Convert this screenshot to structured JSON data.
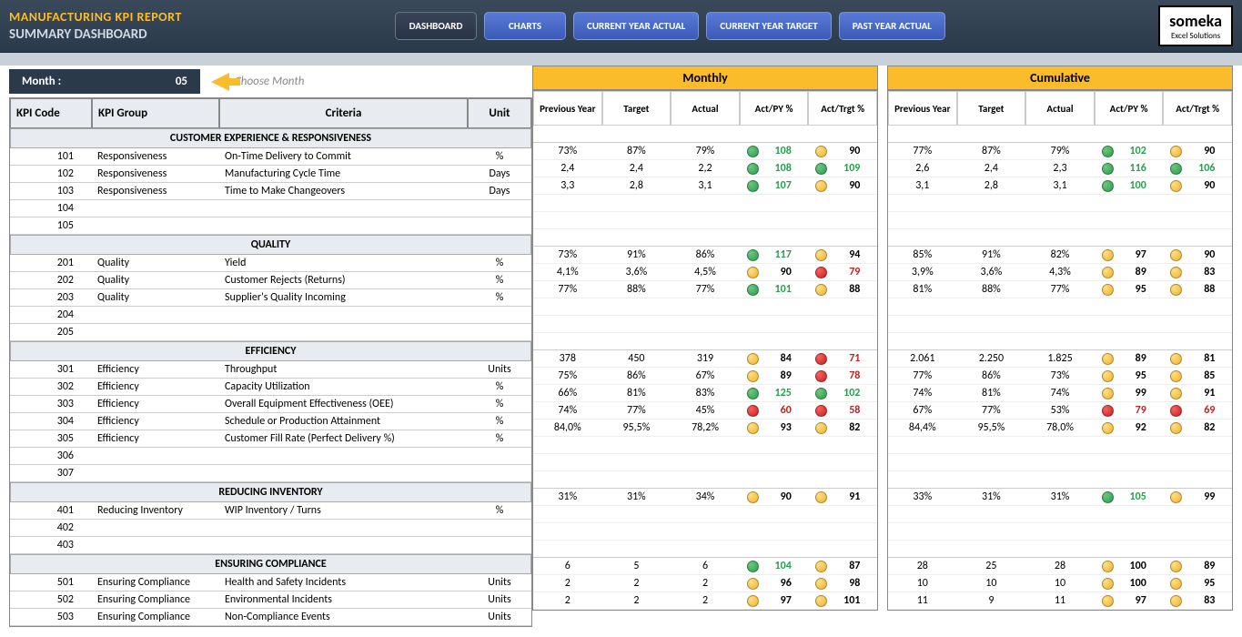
{
  "header": {
    "title": "MANUFACTURING KPI REPORT",
    "subtitle": "SUMMARY DASHBOARD",
    "logo": {
      "name": "someka",
      "sub": "Excel Solutions"
    },
    "nav": [
      "DASHBOARD",
      "CHARTS",
      "CURRENT YEAR ACTUAL",
      "CURRENT YEAR TARGET",
      "PAST YEAR ACTUAL"
    ]
  },
  "controls": {
    "month_label": "Month :",
    "month_value": "05",
    "choose_month": "Choose Month"
  },
  "left_cols": [
    "KPI Code",
    "KPI Group",
    "Criteria",
    "Unit"
  ],
  "section_titles": {
    "monthly": "Monthly",
    "cumulative": "Cumulative"
  },
  "data_cols": [
    "Previous Year",
    "Target",
    "Actual",
    "Act/PY %",
    "Act/Trgt %"
  ],
  "groups": [
    {
      "title": "CUSTOMER EXPERIENCE & RESPONSIVENESS",
      "rows": [
        {
          "code": "101",
          "group": "Responsiveness",
          "criteria": "On-Time Delivery to Commit",
          "unit": "%",
          "monthly": {
            "py": "73%",
            "target": "87%",
            "actual": "79%",
            "actpy": {
              "v": "108",
              "c": "green"
            },
            "acttrgt": {
              "v": "90",
              "c": "yellow"
            }
          },
          "cumulative": {
            "py": "77%",
            "target": "87%",
            "actual": "79%",
            "actpy": {
              "v": "102",
              "c": "green"
            },
            "acttrgt": {
              "v": "90",
              "c": "yellow"
            }
          }
        },
        {
          "code": "102",
          "group": "Responsiveness",
          "criteria": "Manufacturing Cycle Time",
          "unit": "Days",
          "monthly": {
            "py": "2,4",
            "target": "2,4",
            "actual": "2,2",
            "actpy": {
              "v": "108",
              "c": "green"
            },
            "acttrgt": {
              "v": "109",
              "c": "green"
            }
          },
          "cumulative": {
            "py": "2,6",
            "target": "2,4",
            "actual": "2,3",
            "actpy": {
              "v": "116",
              "c": "green"
            },
            "acttrgt": {
              "v": "106",
              "c": "green"
            }
          }
        },
        {
          "code": "103",
          "group": "Responsiveness",
          "criteria": "Time to Make Changeovers",
          "unit": "Days",
          "monthly": {
            "py": "3,3",
            "target": "2,8",
            "actual": "3,1",
            "actpy": {
              "v": "107",
              "c": "green"
            },
            "acttrgt": {
              "v": "90",
              "c": "yellow"
            }
          },
          "cumulative": {
            "py": "3,1",
            "target": "2,8",
            "actual": "3,1",
            "actpy": {
              "v": "100",
              "c": "green"
            },
            "acttrgt": {
              "v": "90",
              "c": "yellow"
            }
          }
        },
        {
          "code": "104",
          "group": "",
          "criteria": "",
          "unit": "",
          "monthly": null,
          "cumulative": null
        },
        {
          "code": "105",
          "group": "",
          "criteria": "",
          "unit": "",
          "monthly": null,
          "cumulative": null
        }
      ]
    },
    {
      "title": "QUALITY",
      "rows": [
        {
          "code": "201",
          "group": "Quality",
          "criteria": "Yield",
          "unit": "%",
          "monthly": {
            "py": "73%",
            "target": "91%",
            "actual": "86%",
            "actpy": {
              "v": "117",
              "c": "green"
            },
            "acttrgt": {
              "v": "94",
              "c": "yellow"
            }
          },
          "cumulative": {
            "py": "85%",
            "target": "91%",
            "actual": "82%",
            "actpy": {
              "v": "97",
              "c": "yellow"
            },
            "acttrgt": {
              "v": "90",
              "c": "yellow"
            }
          }
        },
        {
          "code": "202",
          "group": "Quality",
          "criteria": "Customer Rejects (Returns)",
          "unit": "%",
          "monthly": {
            "py": "4,1%",
            "target": "3,6%",
            "actual": "4,5%",
            "actpy": {
              "v": "90",
              "c": "yellow"
            },
            "acttrgt": {
              "v": "79",
              "c": "red"
            }
          },
          "cumulative": {
            "py": "3,9%",
            "target": "3,6%",
            "actual": "4,3%",
            "actpy": {
              "v": "89",
              "c": "yellow"
            },
            "acttrgt": {
              "v": "83",
              "c": "yellow"
            }
          }
        },
        {
          "code": "203",
          "group": "Quality",
          "criteria": "Supplier's Quality Incoming",
          "unit": "%",
          "monthly": {
            "py": "77%",
            "target": "88%",
            "actual": "77%",
            "actpy": {
              "v": "101",
              "c": "green"
            },
            "acttrgt": {
              "v": "88",
              "c": "yellow"
            }
          },
          "cumulative": {
            "py": "81%",
            "target": "88%",
            "actual": "77%",
            "actpy": {
              "v": "95",
              "c": "yellow"
            },
            "acttrgt": {
              "v": "88",
              "c": "yellow"
            }
          }
        },
        {
          "code": "204",
          "group": "",
          "criteria": "",
          "unit": "",
          "monthly": null,
          "cumulative": null
        },
        {
          "code": "205",
          "group": "",
          "criteria": "",
          "unit": "",
          "monthly": null,
          "cumulative": null
        }
      ]
    },
    {
      "title": "EFFICIENCY",
      "rows": [
        {
          "code": "301",
          "group": "Efficiency",
          "criteria": "Throughput",
          "unit": "Units",
          "monthly": {
            "py": "378",
            "target": "450",
            "actual": "319",
            "actpy": {
              "v": "84",
              "c": "yellow"
            },
            "acttrgt": {
              "v": "71",
              "c": "red"
            }
          },
          "cumulative": {
            "py": "2.061",
            "target": "2.250",
            "actual": "1.825",
            "actpy": {
              "v": "89",
              "c": "yellow"
            },
            "acttrgt": {
              "v": "81",
              "c": "yellow"
            }
          }
        },
        {
          "code": "302",
          "group": "Efficiency",
          "criteria": "Capacity Utilization",
          "unit": "%",
          "monthly": {
            "py": "75%",
            "target": "86%",
            "actual": "67%",
            "actpy": {
              "v": "89",
              "c": "yellow"
            },
            "acttrgt": {
              "v": "78",
              "c": "red"
            }
          },
          "cumulative": {
            "py": "77%",
            "target": "86%",
            "actual": "73%",
            "actpy": {
              "v": "95",
              "c": "yellow"
            },
            "acttrgt": {
              "v": "85",
              "c": "yellow"
            }
          }
        },
        {
          "code": "303",
          "group": "Efficiency",
          "criteria": "Overall Equipment Effectiveness (OEE)",
          "unit": "%",
          "monthly": {
            "py": "66%",
            "target": "81%",
            "actual": "83%",
            "actpy": {
              "v": "125",
              "c": "green"
            },
            "acttrgt": {
              "v": "102",
              "c": "green"
            }
          },
          "cumulative": {
            "py": "74%",
            "target": "81%",
            "actual": "74%",
            "actpy": {
              "v": "99",
              "c": "yellow"
            },
            "acttrgt": {
              "v": "91",
              "c": "yellow"
            }
          }
        },
        {
          "code": "304",
          "group": "Efficiency",
          "criteria": "Schedule or Production Attainment",
          "unit": "%",
          "monthly": {
            "py": "74%",
            "target": "77%",
            "actual": "45%",
            "actpy": {
              "v": "60",
              "c": "red"
            },
            "acttrgt": {
              "v": "58",
              "c": "red"
            }
          },
          "cumulative": {
            "py": "67%",
            "target": "77%",
            "actual": "53%",
            "actpy": {
              "v": "79",
              "c": "red"
            },
            "acttrgt": {
              "v": "69",
              "c": "red"
            }
          }
        },
        {
          "code": "305",
          "group": "Efficiency",
          "criteria": "Customer Fill Rate (Perfect Delivery %)",
          "unit": "%",
          "monthly": {
            "py": "84,0%",
            "target": "95,5%",
            "actual": "78,2%",
            "actpy": {
              "v": "93",
              "c": "yellow"
            },
            "acttrgt": {
              "v": "82",
              "c": "yellow"
            }
          },
          "cumulative": {
            "py": "84,4%",
            "target": "95,5%",
            "actual": "78,0%",
            "actpy": {
              "v": "92",
              "c": "yellow"
            },
            "acttrgt": {
              "v": "82",
              "c": "yellow"
            }
          }
        },
        {
          "code": "306",
          "group": "",
          "criteria": "",
          "unit": "",
          "monthly": null,
          "cumulative": null
        },
        {
          "code": "307",
          "group": "",
          "criteria": "",
          "unit": "",
          "monthly": null,
          "cumulative": null
        }
      ]
    },
    {
      "title": "REDUCING INVENTORY",
      "rows": [
        {
          "code": "401",
          "group": "Reducing Inventory",
          "criteria": "WIP Inventory / Turns",
          "unit": "%",
          "monthly": {
            "py": "31%",
            "target": "31%",
            "actual": "34%",
            "actpy": {
              "v": "90",
              "c": "yellow"
            },
            "acttrgt": {
              "v": "91",
              "c": "yellow"
            }
          },
          "cumulative": {
            "py": "33%",
            "target": "31%",
            "actual": "31%",
            "actpy": {
              "v": "105",
              "c": "green"
            },
            "acttrgt": {
              "v": "99",
              "c": "yellow"
            }
          }
        },
        {
          "code": "402",
          "group": "",
          "criteria": "",
          "unit": "",
          "monthly": null,
          "cumulative": null
        },
        {
          "code": "403",
          "group": "",
          "criteria": "",
          "unit": "",
          "monthly": null,
          "cumulative": null
        }
      ]
    },
    {
      "title": "ENSURING COMPLIANCE",
      "rows": [
        {
          "code": "501",
          "group": "Ensuring Compliance",
          "criteria": "Health and Safety Incidents",
          "unit": "Units",
          "monthly": {
            "py": "6",
            "target": "5",
            "actual": "6",
            "actpy": {
              "v": "104",
              "c": "green"
            },
            "acttrgt": {
              "v": "87",
              "c": "yellow"
            }
          },
          "cumulative": {
            "py": "28",
            "target": "25",
            "actual": "28",
            "actpy": {
              "v": "100",
              "c": "yellow"
            },
            "acttrgt": {
              "v": "89",
              "c": "yellow"
            }
          }
        },
        {
          "code": "502",
          "group": "Ensuring Compliance",
          "criteria": "Environmental Incidents",
          "unit": "Units",
          "monthly": {
            "py": "2",
            "target": "2",
            "actual": "2",
            "actpy": {
              "v": "96",
              "c": "yellow"
            },
            "acttrgt": {
              "v": "98",
              "c": "yellow"
            }
          },
          "cumulative": {
            "py": "10",
            "target": "10",
            "actual": "10",
            "actpy": {
              "v": "100",
              "c": "yellow"
            },
            "acttrgt": {
              "v": "95",
              "c": "yellow"
            }
          }
        },
        {
          "code": "503",
          "group": "Ensuring Compliance",
          "criteria": "Non-Compliance Events",
          "unit": "Units",
          "monthly": {
            "py": "2",
            "target": "2",
            "actual": "2",
            "actpy": {
              "v": "97",
              "c": "yellow"
            },
            "acttrgt": {
              "v": "101",
              "c": "yellow"
            }
          },
          "cumulative": {
            "py": "11",
            "target": "9",
            "actual": "11",
            "actpy": {
              "v": "97",
              "c": "yellow"
            },
            "acttrgt": {
              "v": "83",
              "c": "yellow"
            }
          }
        }
      ]
    }
  ]
}
